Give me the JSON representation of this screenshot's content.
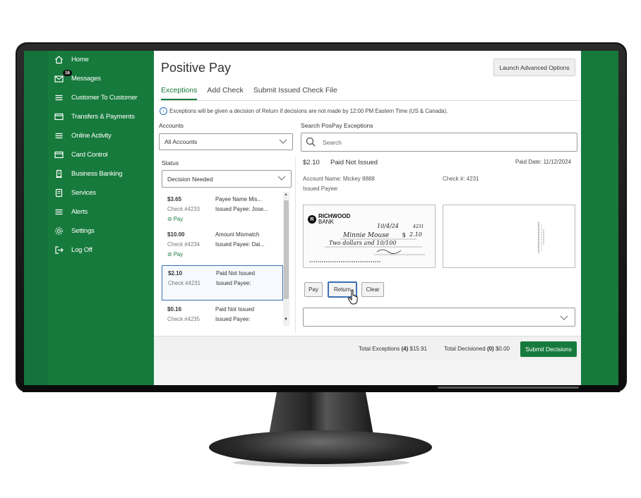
{
  "sidebar": {
    "items": [
      {
        "label": "Home",
        "icon": "home-icon"
      },
      {
        "label": "Messages",
        "icon": "mail-icon",
        "badge": "16"
      },
      {
        "label": "Customer To Customer",
        "icon": "list-icon"
      },
      {
        "label": "Transfers & Payments",
        "icon": "card-icon"
      },
      {
        "label": "Online Activity",
        "icon": "list-icon"
      },
      {
        "label": "Card Control",
        "icon": "card-icon"
      },
      {
        "label": "Business Banking",
        "icon": "building-icon"
      },
      {
        "label": "Services",
        "icon": "document-icon"
      },
      {
        "label": "Alerts",
        "icon": "list-icon"
      },
      {
        "label": "Settings",
        "icon": "gear-icon"
      },
      {
        "label": "Log Off",
        "icon": "logout-icon"
      }
    ]
  },
  "page": {
    "title": "Positive Pay",
    "advanced_button": "Launch Advanced Options",
    "tabs": [
      "Exceptions",
      "Add Check",
      "Submit Issued Check File"
    ],
    "info_text": "Exceptions will be given a decision of Return if decisions are not made by 12:00 PM Eastern Time (US & Canada)."
  },
  "filters": {
    "accounts_label": "Accounts",
    "accounts_value": "All Accounts",
    "search_label": "Search PosPay Exceptions",
    "search_placeholder": "Search",
    "status_label": "Status",
    "status_value": "Decision Needed"
  },
  "exceptions": [
    {
      "amount": "$3.65",
      "check": "Check #4233",
      "decision": "Pay",
      "reason": "Payee Name Mis...",
      "payee": "Issued Payee: Jose..."
    },
    {
      "amount": "$10.00",
      "check": "Check #4234",
      "decision": "Pay",
      "reason": "Amount Mismatch",
      "payee": "Issued Payee: Dai..."
    },
    {
      "amount": "$2.10",
      "check": "Check #4231",
      "decision": "",
      "reason": "Paid Not Issued",
      "payee": "Issued Payee:"
    },
    {
      "amount": "$0.16",
      "check": "Check #4235",
      "decision": "",
      "reason": "Paid Not Issued",
      "payee": "Issued Payee:"
    }
  ],
  "detail": {
    "amount": "$2.10",
    "status": "Paid Not Issued",
    "paid_date": "Paid Date: 11/12/2024",
    "account_name": "Account Name: Mickey 8888",
    "check_no": "Check #: 4231",
    "issued_payee": "Issued Payee:",
    "check": {
      "bank": "RICHWOOD",
      "bank_sub": "BANK",
      "date": "10/4/24",
      "number": "4231",
      "payee": "Minnie Mouse",
      "amount": "2.10",
      "written": "Two dollars and 10/100"
    },
    "buttons": {
      "pay": "Pay",
      "return": "Return",
      "clear": "Clear"
    }
  },
  "footer": {
    "total_exceptions_label": "Total Exceptions",
    "total_exceptions_count": "(4)",
    "total_exceptions_amount": "$15.91",
    "total_decisioned_label": "Total Decisioned",
    "total_decisioned_count": "(0)",
    "total_decisioned_amount": "$0.00",
    "submit": "Submit Decisions"
  },
  "colors": {
    "brand": "#167a3c",
    "focus": "#3b6fb6"
  }
}
